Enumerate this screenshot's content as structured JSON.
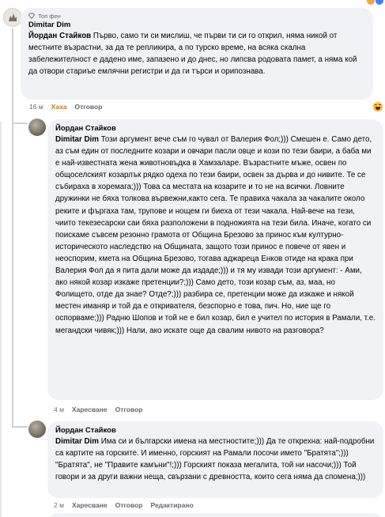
{
  "top_comment": {
    "badge": "Топ фен",
    "author": "Dimitar Dim",
    "mention": "Йордан Стайков",
    "text": " Първо, само ти си мислиш, че първи ти си го открил, няма никой от местните възрастни, за да те репликира, а по турско време, на всяка скална забележителност е дадено име, запазено и до днес, но липсва родовата памет, а няма кой да отвори стариъе емлячни регистри и да ги търси и орипознава.",
    "time": "16 м",
    "reaction_label": "Хаха",
    "reply_label": "Отговор",
    "reaction_icon": "haha-emoji-icon"
  },
  "reply1": {
    "author": "Йордан Стайков",
    "mention": "Dimitar Dim",
    "text": " Този аргумент вече съм го чувал от Валерия Фол;))) Смешен е. Само дето, аз съм един от последните козари и овчари пасли овце и кози по тези баири, а баба ми е най-известната жена животновъдка в Хамзаларе. Възрастните мъже, освен по общоселският козарлък рядко одеха по тези баири, освен за дърва и до нивите. Те се събираха в хоремага;))) Това са местата на козарите и то не на всички. Ловните дружинки не бяха толкова вървежни,както сега. Те правиха чакала за чакалите около реките и фъргаха там, трупове и нощем ги биеха от тези чакала. Най-вече на тези, чиито текезесарски саи бяха разположени в подножията на тези била. Иначе, когато си поискаме съвсем резонно грамота от Община Брезово за принос към културно-историческото наследство на Общината, защото този принос е повече от явен и неоспорим, кмета на Община Брезово, тогава аджареца Енков отиде на крака при Валерия Фол да я пита дали може да издаде;))) и тя му извади този аргумент: - Ами, ако някой козар изкаже претенции?;))) Само дето, този козар съм, аз, маа, но Фолището, отде да знае? Отде?;))) разбира се, претенции може да изкаже и някой местен иманяр и той да е откривателя, безспорно е това, пич. Но, ние ще го оспорваме;))) Радню Шопов и той не е бил козар, бил е учител по история в Рамали, т.е. мегандски чивяк;))) Нали, ако искате още да свалим нивото на разговора?",
    "time": "4 м",
    "like_label": "Харесване",
    "reply_label": "Отговор"
  },
  "reply2": {
    "author": "Йордан Стайков",
    "mention": "Dimitar Dim",
    "text": " Има си и български имена на местностите;))) Да те открехна: най-подробни са картите на горските. И именно, горският на Рамали посочи името \"Братята\";))) \"Братята\", не \"Правите камъни\"!;))) Горският показа мегалита, той ни насочи;))) Той говори и за други важни неща, свързани с древността, които сега няма да спомена;)))",
    "time": "2 м",
    "like_label": "Харесване",
    "reply_label": "Отговор",
    "edited_label": "Редактирано"
  }
}
